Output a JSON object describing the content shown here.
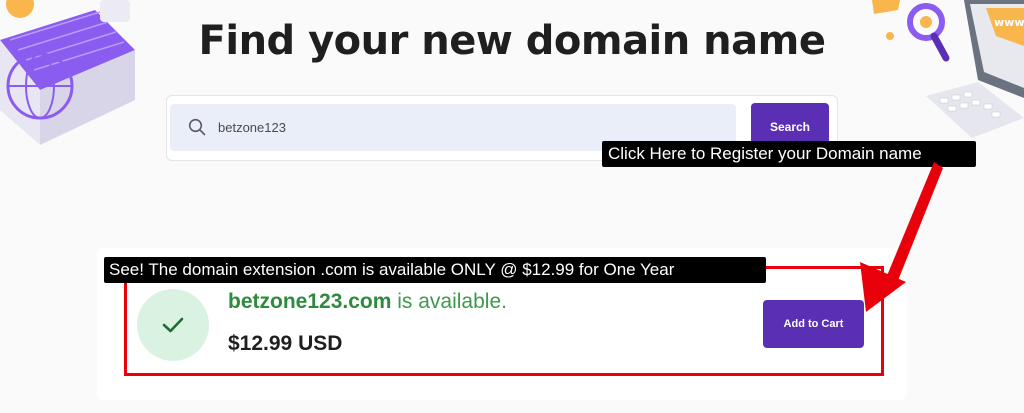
{
  "page": {
    "title": "Find your new domain name"
  },
  "search": {
    "value": "betzone123",
    "button_label": "Search"
  },
  "annotations": {
    "top_callout": "Click Here to Register your Domain name",
    "bottom_callout": "See! The domain extension .com is available ONLY @ $12.99 for One Year"
  },
  "result": {
    "domain": "betzone123.com",
    "status": " is available.",
    "price": "$12.99 USD",
    "cart_button_label": "Add to Cart"
  },
  "colors": {
    "accent": "#5b2fb3",
    "success": "#2e8b3e",
    "highlight": "#e8000b"
  },
  "icons": [
    "search-icon",
    "check-icon",
    "globe-icon",
    "magnifier-icon",
    "computer-icon"
  ]
}
